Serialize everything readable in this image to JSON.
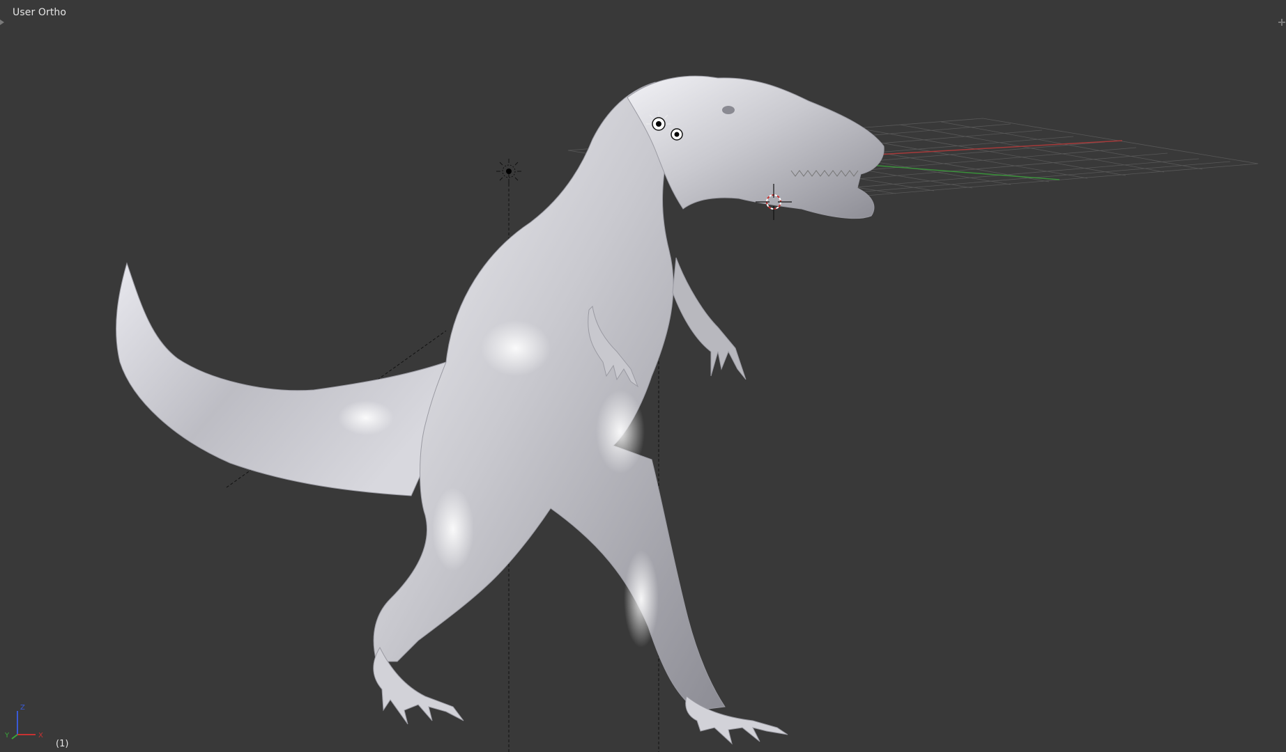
{
  "viewport": {
    "view_name": "User Ortho",
    "frame_number": "(1)",
    "background_color": "#393939",
    "grid_color": "#5a5a5a",
    "x_axis_color": "#a63a3a",
    "y_axis_color": "#3aa63a",
    "mesh_color": "#d6d6dc"
  },
  "axes_gizmo": {
    "z_label": "Z",
    "y_label": "Y",
    "x_label": "X"
  },
  "icons": {
    "top_left_corner": "area-split-widget-icon",
    "top_right_corner": "add-region-widget-icon",
    "lamps": [
      "lamp-icon",
      "lamp-icon",
      "lamp-icon"
    ],
    "cursor": "3d-cursor-icon"
  }
}
